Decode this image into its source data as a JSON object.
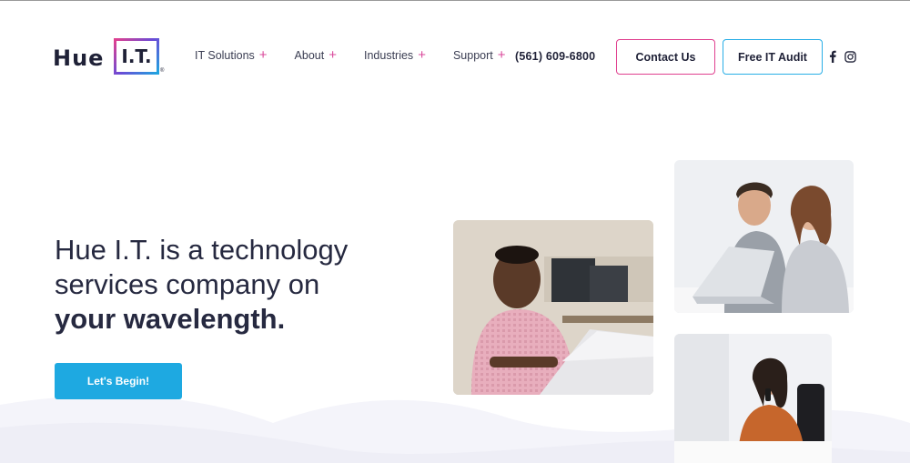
{
  "brand": {
    "logo_word": "Hue",
    "logo_box": "I.T.",
    "logo_reg": "®"
  },
  "nav": {
    "items": [
      {
        "label": "IT Solutions",
        "plus": "+"
      },
      {
        "label": "About",
        "plus": "+"
      },
      {
        "label": "Industries",
        "plus": "+"
      },
      {
        "label": "Support",
        "plus": "+"
      }
    ],
    "phone": "(561) 609-6800",
    "contact_label": "Contact Us",
    "audit_label": "Free IT Audit",
    "social": [
      "facebook-icon",
      "instagram-icon"
    ]
  },
  "hero": {
    "line1": "Hue I.T. is a technology",
    "line2": "services company on",
    "line3": "your wavelength.",
    "cta_label": "Let's Begin!"
  },
  "colors": {
    "accent_pink": "#e0408f",
    "accent_blue": "#29aee6",
    "cta_blue": "#1ea9e1",
    "text_dark": "#262940"
  }
}
